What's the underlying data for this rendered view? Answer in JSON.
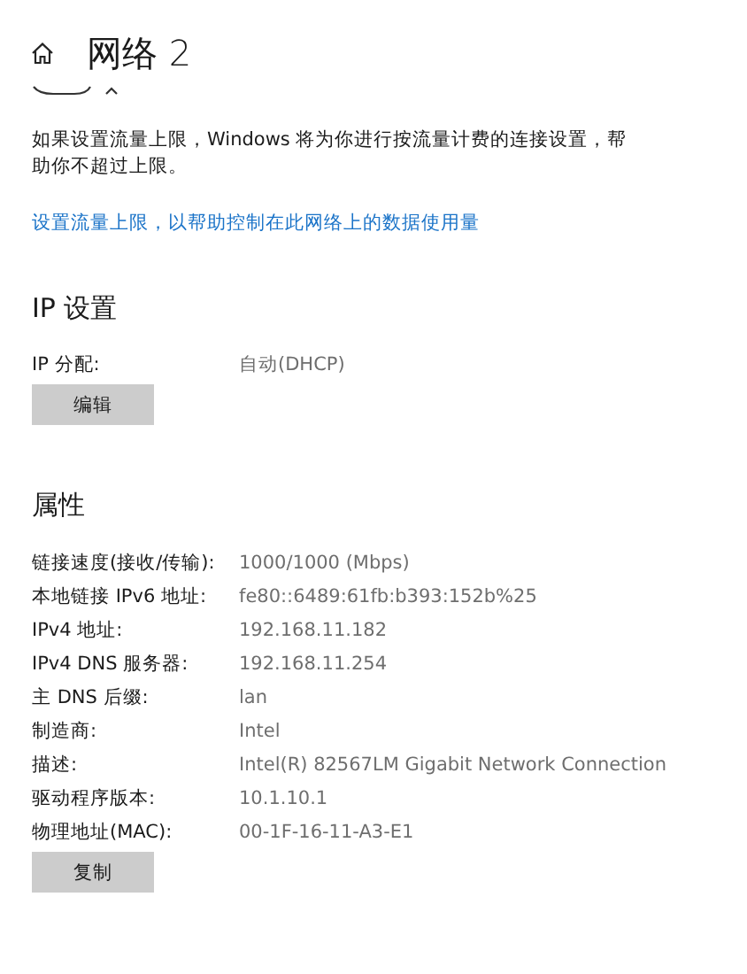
{
  "header": {
    "title": "网络 2"
  },
  "metered": {
    "description": "如果设置流量上限，Windows 将为你进行按流量计费的连接设置，帮助你不超过上限。",
    "link": "设置流量上限，以帮助控制在此网络上的数据使用量"
  },
  "ip_settings": {
    "heading": "IP 设置",
    "rows": [
      {
        "label": "IP 分配:",
        "value": "自动(DHCP)"
      }
    ],
    "button": "编辑"
  },
  "properties": {
    "heading": "属性",
    "rows": [
      {
        "label": "链接速度(接收/传输):",
        "value": "1000/1000 (Mbps)"
      },
      {
        "label": "本地链接 IPv6 地址:",
        "value": "fe80::6489:61fb:b393:152b%25"
      },
      {
        "label": "IPv4 地址:",
        "value": "192.168.11.182"
      },
      {
        "label": "IPv4 DNS 服务器:",
        "value": "192.168.11.254"
      },
      {
        "label": "主 DNS 后缀:",
        "value": "lan"
      },
      {
        "label": "制造商:",
        "value": "Intel"
      },
      {
        "label": "描述:",
        "value": "Intel(R) 82567LM Gigabit Network Connection"
      },
      {
        "label": "驱动程序版本:",
        "value": "10.1.10.1"
      },
      {
        "label": "物理地址(MAC):",
        "value": "00-1F-16-11-A3-E1"
      }
    ],
    "button": "复制"
  }
}
